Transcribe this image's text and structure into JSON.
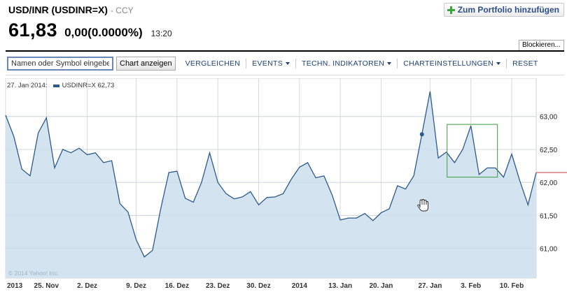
{
  "header": {
    "symbol_title": "USD/INR (USDINR=X)",
    "exchange": "- CCY",
    "price": "61,83",
    "change": "0,00",
    "change_pct": "(0.0000%)",
    "time": "13:20",
    "portfolio_button": "Zum Portfolio hinzufügen"
  },
  "blockieren_tab": "Blockieren...",
  "toolbar": {
    "search_placeholder": "Namen oder Symbol eingeben",
    "chart_button": "Chart anzeigen",
    "menu": [
      {
        "label": "VERGLEICHEN",
        "dropdown": false
      },
      {
        "label": "EVENTS",
        "dropdown": true
      },
      {
        "label": "TECHN. INDIKATOREN",
        "dropdown": true
      },
      {
        "label": "CHARTEINSTELLUNGEN",
        "dropdown": true
      },
      {
        "label": "RESET",
        "dropdown": false
      }
    ]
  },
  "legend": {
    "date": "27. Jan 2014:",
    "series_label": "USDINR=X 62,73"
  },
  "copyright": "© 2014 Yahoo! Inc.",
  "colors": {
    "line": "#2d5a8c",
    "fill": "#d3e4f0",
    "grid": "#d9d9d9",
    "current_price_line": "#c94040",
    "selection_box": "#3c9a3c"
  },
  "chart_data": {
    "type": "area",
    "series": [
      {
        "name": "USDINR=X",
        "values": [
          63.02,
          62.7,
          62.2,
          62.1,
          62.75,
          62.98,
          62.22,
          62.5,
          62.45,
          62.52,
          62.42,
          62.45,
          62.3,
          62.33,
          61.68,
          61.55,
          61.13,
          60.87,
          60.97,
          61.6,
          62.15,
          62.17,
          61.76,
          61.7,
          62.0,
          62.45,
          62.0,
          61.83,
          61.75,
          61.78,
          61.86,
          61.66,
          61.77,
          61.78,
          61.83,
          62.05,
          62.23,
          62.3,
          62.07,
          62.1,
          61.81,
          61.43,
          61.46,
          61.46,
          61.53,
          61.42,
          61.54,
          61.6,
          61.95,
          61.9,
          62.1,
          62.73,
          63.38,
          62.37,
          62.46,
          62.3,
          62.5,
          62.86,
          62.12,
          62.22,
          62.22,
          62.08,
          62.43,
          62.02,
          61.66,
          62.15
        ]
      }
    ],
    "x_tick_labels": [
      "2013",
      "25. Nov",
      "2. Dez",
      "9. Dez",
      "16. Dez",
      "23. Dez",
      "30. Dez",
      "2014",
      "13. Jan",
      "20. Jan",
      "27. Jan",
      "3. Feb",
      "10. Feb"
    ],
    "y_tick_labels": [
      "63,00",
      "62,50",
      "62,00",
      "61,50",
      "61,00"
    ],
    "y_ticks": [
      63.0,
      62.5,
      62.0,
      61.5,
      61.0
    ],
    "ylim": [
      60.55,
      63.58
    ],
    "current_price": 62.15,
    "highlighted_point": {
      "value": 62.73,
      "label": "27. Jan 2014"
    },
    "grid": true
  }
}
